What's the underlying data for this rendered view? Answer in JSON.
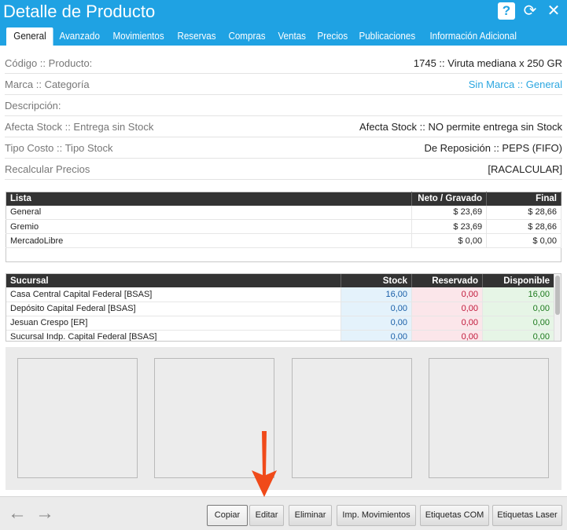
{
  "window": {
    "title": "Detalle de Producto"
  },
  "header_icons": [
    {
      "name": "help-icon",
      "glyph": "?"
    },
    {
      "name": "refresh-icon",
      "glyph": "⟳"
    },
    {
      "name": "close-icon",
      "glyph": "✕"
    }
  ],
  "tabs": [
    {
      "label": "General",
      "active": true
    },
    {
      "label": "Avanzado"
    },
    {
      "label": "Movimientos"
    },
    {
      "label": "Reservas"
    },
    {
      "label": "Compras"
    },
    {
      "label": "Ventas"
    },
    {
      "label": "Precios"
    },
    {
      "label": "Publicaciones"
    },
    {
      "label": "Información Adicional"
    }
  ],
  "info": {
    "codigo": {
      "label": "Código :: Producto:",
      "value": "1745 :: Viruta mediana x 250 GR"
    },
    "marca": {
      "label": "Marca :: Categoría",
      "marca": "Sin Marca",
      "sep": " :: ",
      "categoria": "General"
    },
    "descripcion": {
      "label": "Descripción:",
      "value": ""
    },
    "stock": {
      "label": "Afecta Stock :: Entrega sin Stock",
      "value": "Afecta Stock :: NO permite entrega sin Stock"
    },
    "costo": {
      "label": "Tipo Costo :: Tipo Stock",
      "value": "De Reposición :: PEPS (FIFO)"
    },
    "recalcular": {
      "label": "Recalcular Precios",
      "value": "[RACALCULAR]"
    }
  },
  "prices": {
    "headers": [
      "Lista",
      "Neto / Gravado",
      "Final"
    ],
    "rows": [
      [
        "General",
        "$ 23,69",
        "$ 28,66"
      ],
      [
        "Gremio",
        "$ 23,69",
        "$ 28,66"
      ],
      [
        "MercadoLibre",
        "$ 0,00",
        "$ 0,00"
      ]
    ]
  },
  "stock": {
    "headers": [
      "Sucursal",
      "Stock",
      "Reservado",
      "Disponible"
    ],
    "rows": [
      [
        "Casa Central Capital Federal [BSAS]",
        "16,00",
        "0,00",
        "16,00"
      ],
      [
        "Depósito Capital Federal [BSAS]",
        "0,00",
        "0,00",
        "0,00"
      ],
      [
        "Jesuan Crespo [ER]",
        "0,00",
        "0,00",
        "0,00"
      ],
      [
        "Sucursal Indp. Capital Federal [BSAS]",
        "0,00",
        "0,00",
        "0,00"
      ]
    ]
  },
  "footer": {
    "back_glyph": "←",
    "forward_glyph": "→",
    "buttons": {
      "copiar": "Copiar",
      "editar": "Editar",
      "eliminar": "Eliminar",
      "imp_movimientos": "Imp. Movimientos",
      "etiquetas_com": "Etiquetas COM",
      "etiquetas_laser": "Etiquetas Laser"
    }
  },
  "colors": {
    "accent": "#1fa2e3",
    "annotation_arrow": "#f04a1a"
  }
}
